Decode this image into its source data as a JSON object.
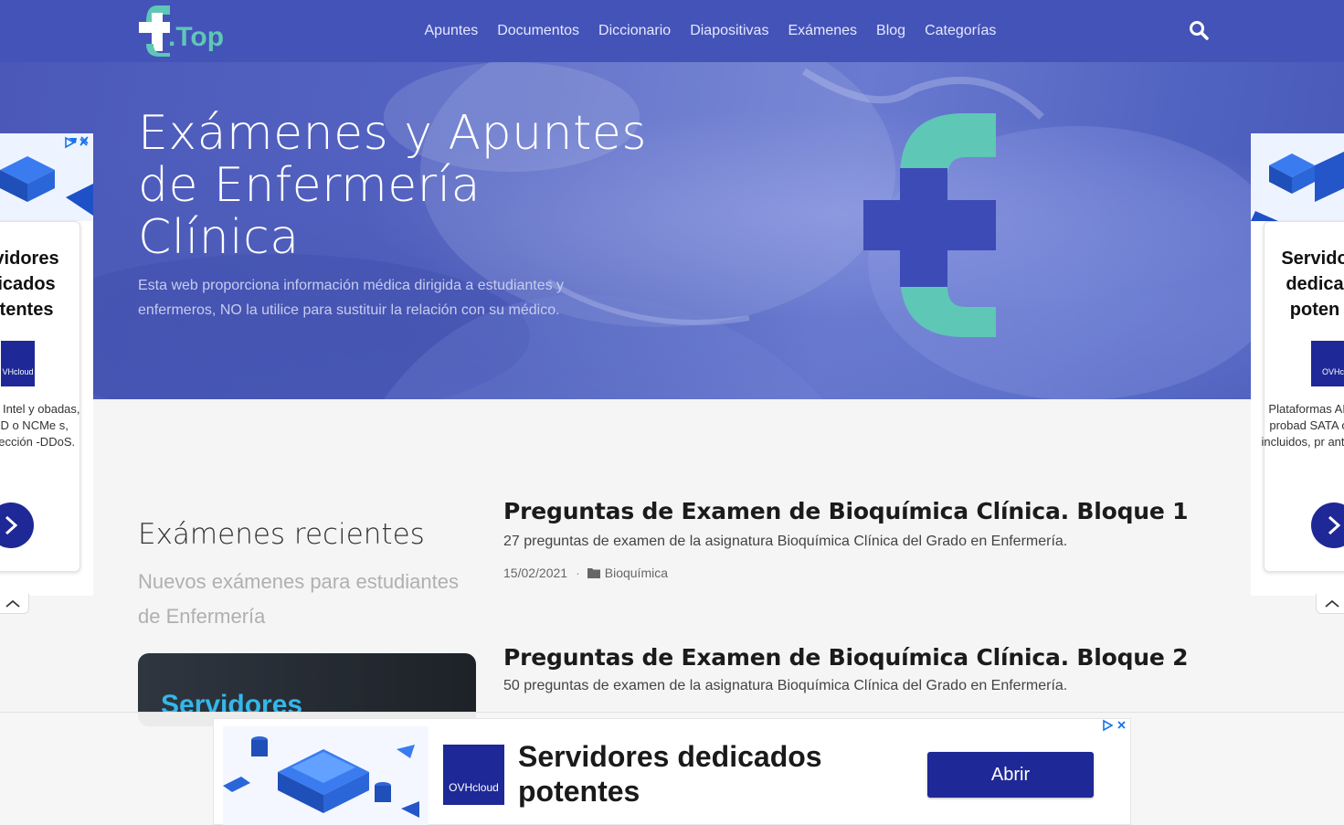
{
  "header": {
    "logo_text": ".Top",
    "nav": [
      "Apuntes",
      "Documentos",
      "Diccionario",
      "Diapositivas",
      "Exámenes",
      "Blog",
      "Categorías"
    ]
  },
  "hero": {
    "title": "Exámenes y Apuntes de Enfermería Clínica",
    "subtitle": "Esta web proporciona información médica dirigida a estudiantes y enfermeros, NO la utilice para sustituir la relación con su médico."
  },
  "section": {
    "title": "Exámenes recientes",
    "subtitle": "Nuevos exámenes para estudiantes de Enfermería",
    "card_text": "Servidores"
  },
  "posts": [
    {
      "title": "Preguntas de Examen de Bioquímica Clínica. Bloque 1",
      "excerpt": "27 preguntas de examen de la asignatura Bioquímica Clínica del Grado en Enfermería.",
      "date": "15/02/2021",
      "category": "Bioquímica"
    },
    {
      "title": "Preguntas de Examen de Bioquímica Clínica. Bloque 2",
      "excerpt": "50 preguntas de examen de la asignatura Bioquímica Clínica del Grado en Enfermería."
    }
  ],
  "left_ad": {
    "heading": "vidores icados tentes",
    "brand": "VHcloud",
    "desc": "rmas Intel y obadas, SSD o NCMe s, protección -DDoS."
  },
  "right_ad": {
    "heading": "Servido dedica poten",
    "brand": "OVHclou",
    "desc": "Plataformas AMD probad SATA o N incluidos, pr anti-DD"
  },
  "bottom_ad": {
    "brand": "OVHcloud",
    "headline": "Servidores dedicados potentes",
    "button": "Abrir"
  },
  "colors": {
    "header": "#4453b8",
    "teal": "#5ec7b5",
    "brand_blue": "#1e2896"
  }
}
